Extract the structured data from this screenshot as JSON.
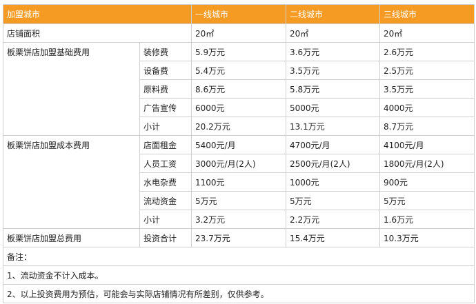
{
  "colors": {
    "header_bg": "#f59a23",
    "header_text": "#ffffff",
    "border": "#cfcfcf"
  },
  "header": [
    "加盟城市",
    "一线城市",
    "二线城市",
    "三线城市"
  ],
  "area_row": {
    "label": "店铺面积",
    "values": [
      "20㎡",
      "20㎡",
      "20㎡"
    ]
  },
  "groups": [
    {
      "label": "板栗饼店加盟基础费用",
      "rows": [
        {
          "item": "装修费",
          "values": [
            "5.9万元",
            "3.6万元",
            "2.6万元"
          ]
        },
        {
          "item": "设备费",
          "values": [
            "5.4万元",
            "3.5万元",
            "2.5万元"
          ]
        },
        {
          "item": "原料费",
          "values": [
            "8.6万元",
            "5.8万元",
            "3.5万元"
          ]
        },
        {
          "item": "广告宣传",
          "values": [
            "6000元",
            "5000元",
            "4000元"
          ]
        },
        {
          "item": "小计",
          "values": [
            "20.2万元",
            "13.1万元",
            "8.7万元"
          ]
        }
      ]
    },
    {
      "label": "板栗饼店加盟成本费用",
      "rows": [
        {
          "item": "店面租金",
          "values": [
            "5400元/月",
            "4700元/月",
            "4100元/月"
          ]
        },
        {
          "item": "人员工资",
          "values": [
            "3000元/月(2人)",
            "2500元/月(2人)",
            "1800元/月(2人)"
          ]
        },
        {
          "item": "水电杂费",
          "values": [
            "1100元",
            "1000元",
            "900元"
          ]
        },
        {
          "item": "流动资金",
          "values": [
            "5万元",
            "5万元",
            "5万元"
          ]
        },
        {
          "item": "小计",
          "values": [
            "3.2万元",
            "2.2万元",
            "1.6万元"
          ]
        }
      ]
    }
  ],
  "total_row": {
    "label": "板栗饼店加盟总费用",
    "item": "投资合计",
    "values": [
      "23.7万元",
      "15.4万元",
      "10.3万元"
    ]
  },
  "notes": [
    "备注：",
    "1、流动资金不计入成本。",
    "2、以上投资费用为预估，可能会与实际店铺情况有所差别，仅供参考。"
  ]
}
